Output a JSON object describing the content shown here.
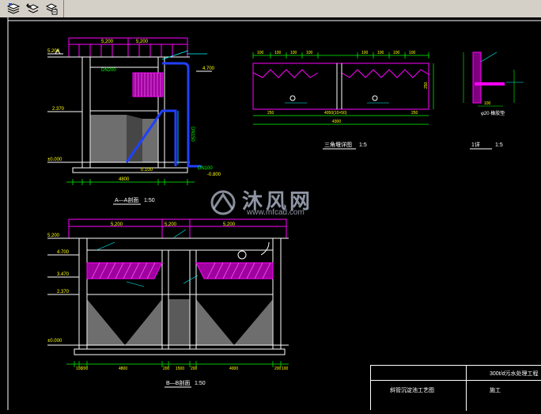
{
  "toolbar": {
    "buttons": [
      {
        "name": "layer-properties-icon"
      },
      {
        "name": "layer-previous-icon"
      },
      {
        "name": "layer-states-icon"
      }
    ]
  },
  "drawing": {
    "elev_top_left": "5.200",
    "elev_a_top": "4.700",
    "elev_a_mid": "2.370",
    "elev_a_zero": "±0.000",
    "elev_a_pipe": "-0.800",
    "elev_b_top": "5.200",
    "elev_b_mid1": "4.700",
    "elev_b_mid2": "3.470",
    "elev_b_mid3": "2.370",
    "elev_b_zero": "±0.000",
    "pipe_dn200": "DN200",
    "pipe_dn150": "DN150",
    "pipe_dn100": "DN100",
    "dim_0100": "0.100",
    "section_a_title": "A—A剖面",
    "section_a_scale": "1:50",
    "section_b_title": "B—B剖面",
    "section_b_scale": "1:50",
    "weir_title": "三角堰详图",
    "weir_scale": "1:5",
    "detail_title": "1详",
    "detail_scale": "1:5",
    "b_dims": [
      "100",
      "200",
      "4800",
      "200",
      "1500",
      "200",
      "4000",
      "200",
      "100"
    ],
    "weir_total": "4300",
    "weir_left": "250",
    "weir_mid": "4050(10×50)",
    "weir_right": "250"
  },
  "title_block": {
    "project": "300t/d污水处理工程",
    "drawing": "斜管沉淀池工艺图",
    "role": "施工"
  },
  "watermark": {
    "name": "沐风网",
    "url": "www.mfcad.com"
  }
}
